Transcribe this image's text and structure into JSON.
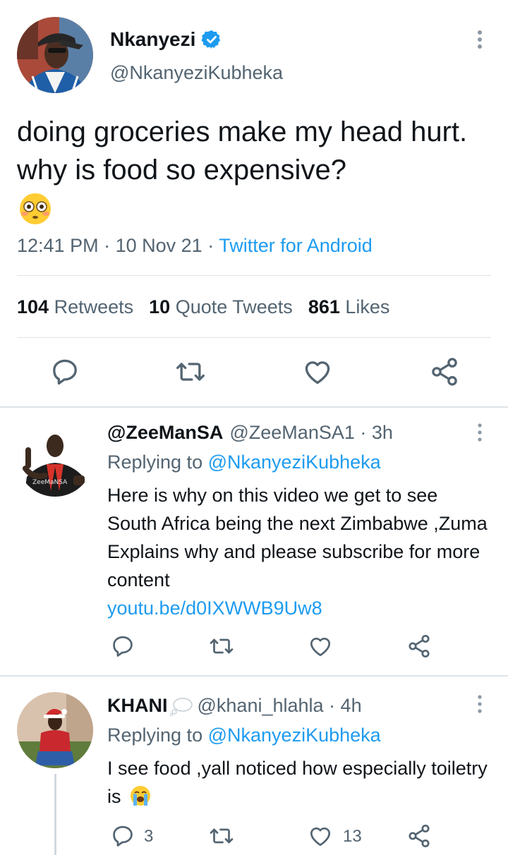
{
  "main_tweet": {
    "author_name": "Nkanyezi",
    "author_handle": "@NkanyeziKubheka",
    "text": "doing groceries make my head hurt. why is food so expensive?",
    "time": "12:41 PM",
    "date": "10 Nov 21",
    "source": "Twitter for Android",
    "stats": {
      "retweets_count": "104",
      "retweets_label": "Retweets",
      "quotes_count": "10",
      "quotes_label": "Quote Tweets",
      "likes_count": "861",
      "likes_label": "Likes"
    }
  },
  "replies": [
    {
      "display_name": "@ZeeManSA",
      "handle": "@ZeeManSA1",
      "age": "3h",
      "replying_prefix": "Replying to",
      "replying_to": "@NkanyeziKubheka",
      "text": "Here is why on this video we get to see South Africa being the next Zimbabwe ,Zuma Explains why and please subscribe for more content",
      "link": "youtu.be/d0IXWWB9Uw8",
      "avatar_shirt_text": "ZeeMaNSA"
    },
    {
      "display_name": "KHANI",
      "handle": "@khani_hlahla",
      "age": "4h",
      "replying_prefix": "Replying to",
      "replying_to": "@NkanyeziKubheka",
      "text": "I see food ,yall noticed how especially toiletry is",
      "reply_count": "3",
      "like_count": "13"
    }
  ],
  "icons": {
    "verified": "verified-badge-icon",
    "more": "more-vertical-icon",
    "reply": "comment-bubble-icon",
    "retweet": "retweet-arrows-icon",
    "like": "heart-icon",
    "share": "share-nodes-icon",
    "emoji_main": "flushed-face-emoji",
    "emoji_reply": "loudly-crying-face-emoji",
    "bubble_after_name": "thought-bubble-emoji"
  },
  "colors": {
    "accent": "#1d9bf0",
    "text": "#0f1419",
    "secondary": "#536471",
    "divider": "#dde3e8"
  }
}
